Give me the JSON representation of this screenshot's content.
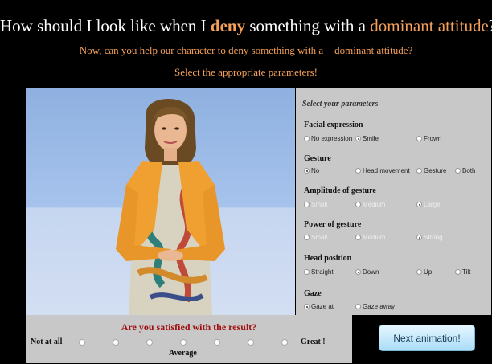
{
  "header": {
    "title_parts": [
      "How should I look like when I ",
      "deny",
      " something with a ",
      "dominant attitude",
      "?"
    ],
    "subtitle_parts": [
      "Now, can you help our character to deny something with a",
      "dominant attitude?"
    ],
    "instruction": "Select the appropriate parameters!"
  },
  "panel": {
    "title": "Select your parameters",
    "groups": [
      {
        "label": "Facial expression",
        "options": [
          "No expression",
          "Smile",
          "Frown"
        ],
        "selected": 1,
        "disabled": false
      },
      {
        "label": "Gesture",
        "options": [
          "No",
          "Head movement",
          "Gesture",
          "Both"
        ],
        "selected": 0,
        "disabled": false
      },
      {
        "label": "Amplitude of gesture",
        "options": [
          "Small",
          "Medium",
          "Large"
        ],
        "selected": 2,
        "disabled": true
      },
      {
        "label": "Power of gesture",
        "options": [
          "Small",
          "Medium",
          "Strong"
        ],
        "selected": 2,
        "disabled": true
      },
      {
        "label": "Head position",
        "options": [
          "Straight",
          "Down",
          "Up",
          "Tilt"
        ],
        "selected": 1,
        "disabled": false
      },
      {
        "label": "Gaze",
        "options": [
          "Gaze at",
          "Gaze away"
        ],
        "selected": 0,
        "disabled": false
      }
    ]
  },
  "rating": {
    "question": "Are you satisfied with the result?",
    "low": "Not at all",
    "mid": "Average",
    "high": "Great !",
    "points": 7
  },
  "next_button": "Next animation!",
  "colors": {
    "accent": "#f5a05a",
    "question": "#a01010",
    "panel": "#c8c8c8",
    "button_top": "#e6f6ff",
    "button_bottom": "#a9ddf7"
  }
}
